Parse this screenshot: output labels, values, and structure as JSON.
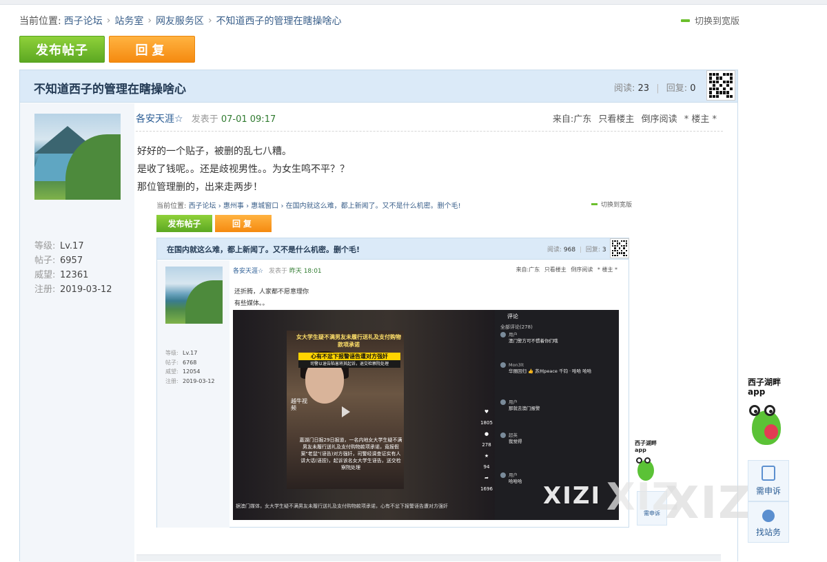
{
  "breadcrumb": {
    "prefix": "当前位置:",
    "items": [
      "西子论坛",
      "站务室",
      "网友服务区",
      "不知道西子的管理在瞎操啥心"
    ],
    "separator": "›"
  },
  "switch_wide": "切换到宽版",
  "buttons": {
    "post": "发布帖子",
    "reply": "回复"
  },
  "thread": {
    "title": "不知道西子的管理在瞎操啥心",
    "read_label": "阅读:",
    "read_count": "23",
    "reply_label": "回复:",
    "reply_count": "0",
    "stat_sep": "|"
  },
  "post": {
    "author": "各安天涯☆",
    "posted_label": "发表于",
    "posted_time": "07-01 09:17",
    "from": "来自:广东",
    "only_author": "只看楼主",
    "reverse": "倒序阅读",
    "floor": "* 楼主 *",
    "lines": [
      "好好的一个贴子，被删的乱七八糟。",
      "是收了钱呢。。还是歧视男性。。为女生鸣不平？？",
      "那位管理删的，出来走两步！"
    ]
  },
  "user_info": [
    {
      "key": "等级:",
      "value": "Lv.17"
    },
    {
      "key": "帖子:",
      "value": "6957"
    },
    {
      "key": "威望:",
      "value": "12361"
    },
    {
      "key": "注册:",
      "value": "2019-03-12"
    }
  ],
  "embedded": {
    "breadcrumb": "当前位置:",
    "crumb_links": "西子论坛 › 惠州事 › 惠城窗口 › 在国内就这么难，都上新闻了。又不是什么机密。删个毛!",
    "switch_wide": "切换到宽版",
    "post_btn": "发布帖子",
    "reply_btn": "回复",
    "title": "在国内就这么难，都上新闻了。又不是什么机密。删个毛!",
    "read_label": "阅读:",
    "read_count": "968",
    "reply_label": "回复:",
    "reply_count": "3",
    "author": "各安天涯☆",
    "posted_label": "发表于",
    "posted_time": "昨天 18:01",
    "from": "来自:广东",
    "only_author": "只看楼主",
    "reverse": "倒序阅读",
    "floor": "* 楼主 *",
    "line1": "还折腾，人家都不愿意理你",
    "line2": "有些媒体。。",
    "info": [
      {
        "key": "等级:",
        "value": "Lv.17"
      },
      {
        "key": "帖子:",
        "value": "6768"
      },
      {
        "key": "威望:",
        "value": "12054"
      },
      {
        "key": "注册:",
        "value": "2019-03-12"
      }
    ],
    "video": {
      "caption_top": "女大学生疑不满男友未履行送礼及支付购物款项承诺",
      "badge": "心有不忿下报警诬告遭对方强奸",
      "badge2": "司警以诬告陷害将其起诉，退交检察院处理",
      "source": "越牛视频",
      "subtext": "嘉湖门日报29日报道，一名内地女大学生疑不满男友未履行送礼及支付购物款项承诺，竟报假案\"老鼠\"(诬告)对方强奸，司警经调查证实有人讲大话(诬捏)，起诉该名女大学生诬告，送交检察院处理",
      "bottom": "据澳门媒体，女大学生疑不满男友未履行送礼及支付购物款项承诺，心有不忿下报警诬告遭对方强奸",
      "icon_counts": [
        "1805",
        "278",
        "94",
        "1696"
      ],
      "tab_active": "评论",
      "comment_head": "全部评论(278)",
      "comments": [
        {
          "name": "用户",
          "text": "澳门警方可不惯着你们哦"
        },
        {
          "name": "Mon3lt",
          "text": "华丽回归 👍 苏州peace 千钧 · 哈哈 哈哈"
        },
        {
          "name": "用户",
          "text": "那就去澳门报警"
        },
        {
          "name": "超英",
          "text": "我觉得"
        },
        {
          "name": "用户",
          "text": "哈哈哈"
        }
      ]
    },
    "mascot": "西子湖畔app",
    "side_btn": "需申诉"
  },
  "watermarks": [
    "XIZI",
    "XIZ",
    "XIZI"
  ],
  "right_sidebar": {
    "mascot_line1": "西子湖畔",
    "mascot_line2": "app",
    "appeal": "需申诉",
    "find_staff": "找站务"
  },
  "colors": {
    "post_button": "#6cba2a",
    "reply_button": "#f7941d",
    "header_bg": "#dbeaf8",
    "link": "#3a5f8a"
  }
}
